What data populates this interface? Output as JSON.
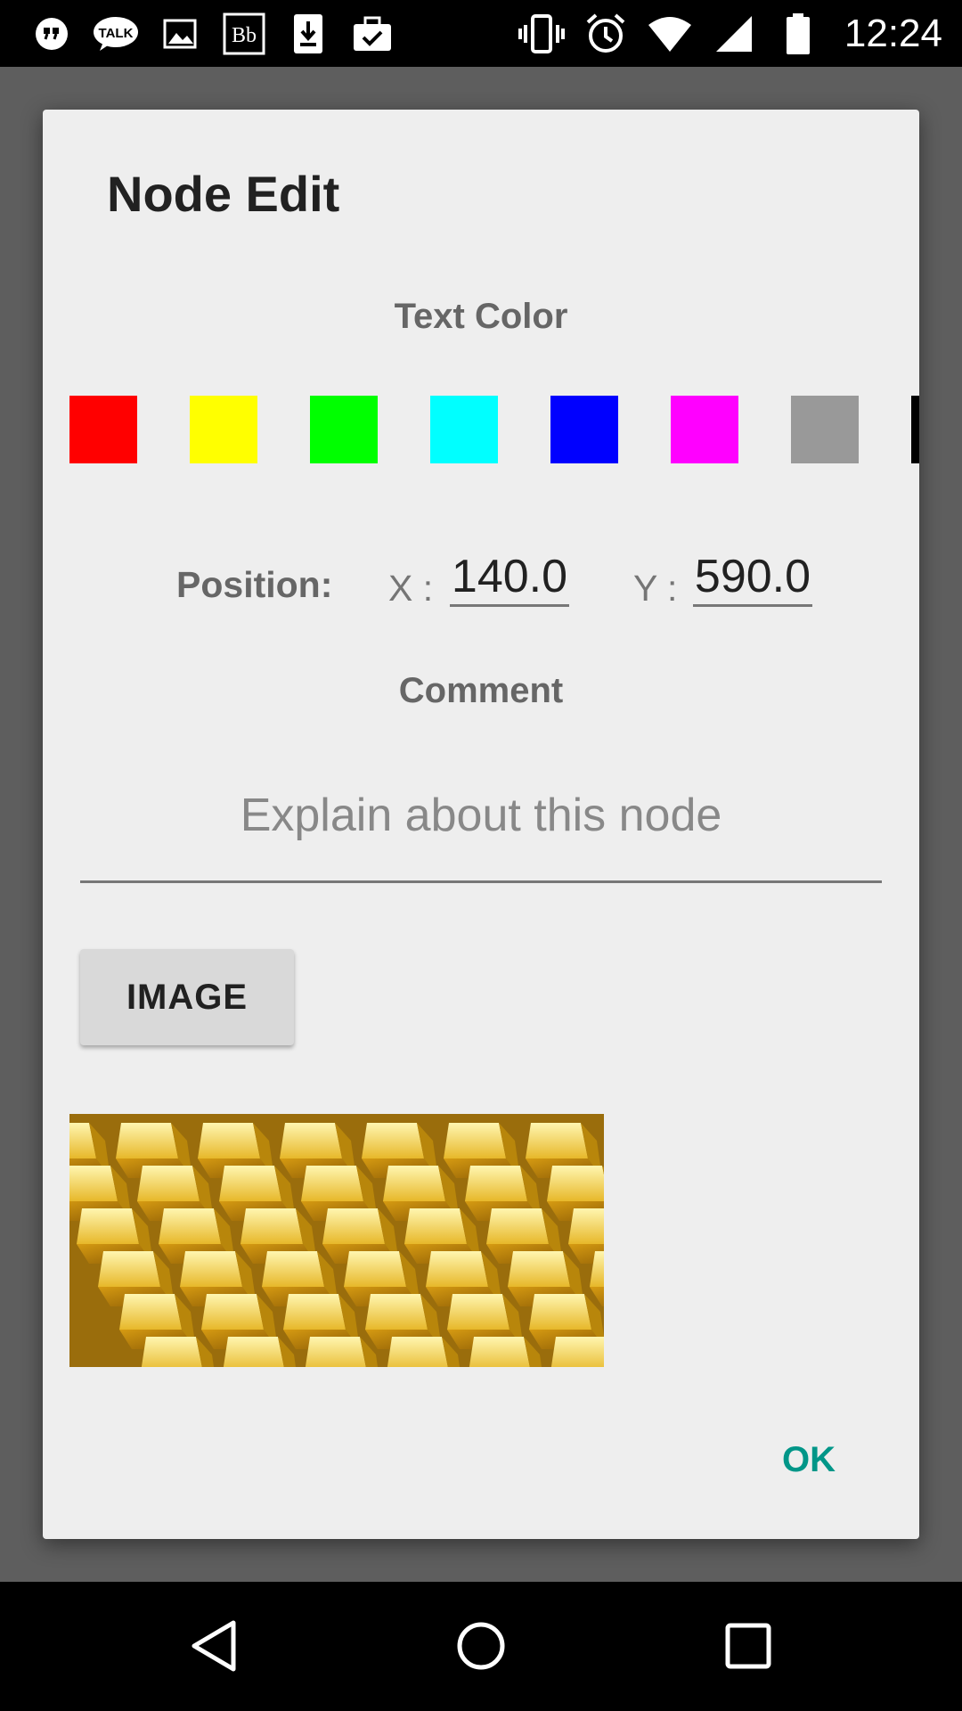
{
  "status_bar": {
    "time": "12:24",
    "left_icons": [
      "chat-bubble-icon",
      "talk-icon",
      "image-icon",
      "blackboard-icon",
      "download-icon",
      "briefcase-check-icon"
    ],
    "talk_text": "TALK",
    "bb_text": "Bb",
    "right_icons": [
      "vibrate-icon",
      "alarm-icon",
      "wifi-icon",
      "signal-icon",
      "battery-icon"
    ]
  },
  "dialog": {
    "title": "Node Edit",
    "text_color_label": "Text Color",
    "swatches": [
      "#ff0000",
      "#ffff00",
      "#00ff00",
      "#00ffff",
      "#0000ff",
      "#ff00ff",
      "#999999",
      "#000000"
    ],
    "position": {
      "label": "Position:",
      "x_label": "X :",
      "x_value": "140.0",
      "y_label": "Y :",
      "y_value": "590.0"
    },
    "comment_label": "Comment",
    "comment_placeholder": "Explain about this node",
    "image_button": "IMAGE",
    "attached_image": "gold-bars-image",
    "ok_button": "OK"
  },
  "nav_bar": {
    "buttons": [
      "back-icon",
      "home-icon",
      "recents-icon"
    ]
  },
  "colors": {
    "accent": "#009688",
    "dialog_bg": "#eeeeee",
    "scrim": "#5e5e5e"
  }
}
